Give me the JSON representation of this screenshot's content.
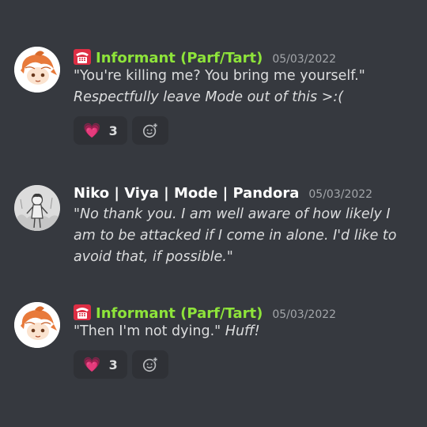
{
  "messages": [
    {
      "username": "Informant (Parf/Tart)",
      "timestamp": "05/03/2022",
      "role_icon": "telephone-icon",
      "lines": [
        {
          "text": "\"You're killing me? You bring me yourself.\"",
          "italic": false
        },
        {
          "text": "Respectfully leave Mode out of this >:(",
          "italic": true
        }
      ],
      "reaction": {
        "emoji": "💗",
        "count": "3"
      }
    },
    {
      "username": "Niko | Viya | Mode | Pandora",
      "timestamp": "05/03/2022",
      "body": "\"No thank you. I am well aware of how likely I am to be attacked if I come in alone. I'd like to avoid that, if possible.\""
    },
    {
      "username": "Informant (Parf/Tart)",
      "timestamp": "05/03/2022",
      "role_icon": "telephone-icon",
      "quote": "\"Then I'm not dying.\"",
      "action": "Huff!",
      "reaction": {
        "emoji": "💗",
        "count": "3"
      }
    }
  ],
  "colors": {
    "background": "#36393f",
    "username_green": "#8ee43a",
    "reaction_bg": "#2f3136",
    "timestamp": "#a3a6aa"
  }
}
